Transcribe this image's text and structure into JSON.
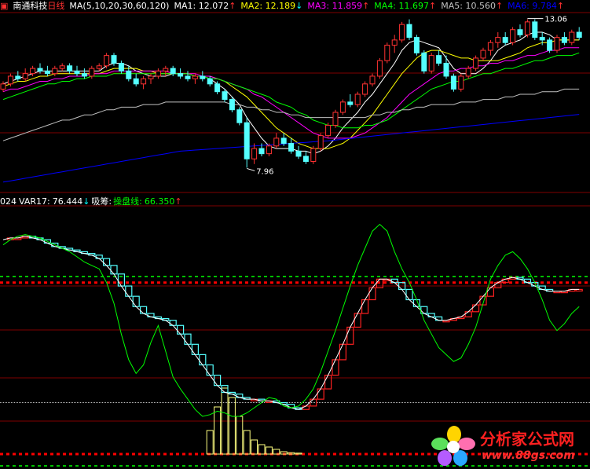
{
  "header1": {
    "stock_name": "南通科技",
    "period": "日线",
    "ma_params": "MA(5,10,20,30,60,120)",
    "ma_items": [
      {
        "label": "MA1:",
        "value": "12.072",
        "arrow": "↑",
        "color": "#ffffff"
      },
      {
        "label": "MA2:",
        "value": "12.189",
        "arrow": "↓",
        "color": "#ffff00"
      },
      {
        "label": "MA3:",
        "value": "11.859",
        "arrow": "↑",
        "color": "#ff00ff"
      },
      {
        "label": "MA4:",
        "value": "11.697",
        "arrow": "↑",
        "color": "#00ff00"
      },
      {
        "label": "MA5:",
        "value": "10.560",
        "arrow": "↑",
        "color": "#c0c0c0"
      },
      {
        "label": "MA6:",
        "value": "9.784",
        "arrow": "↑",
        "color": "#0000ff"
      }
    ]
  },
  "header2": {
    "prefix": "024",
    "var_label": "VAR17:",
    "var_value": "76.444",
    "var_arrow": "↓",
    "label2": "吸筹:",
    "label3": "操盘线:",
    "value3": "66.350",
    "arrow3": "↑"
  },
  "annotations": {
    "low": "7.96",
    "high": "13.06"
  },
  "watermark": {
    "title": "分析家公式网",
    "url": "www.88gs.com"
  },
  "colors": {
    "up": "#ff3232",
    "down": "#54ffff",
    "grid": "#800000",
    "green": "#00ff00",
    "ma_blue": "#0000ff"
  },
  "chart_data": {
    "type": "candlestick",
    "candles": [
      [
        11.0,
        11.3,
        10.9,
        11.2
      ],
      [
        11.2,
        11.6,
        11.1,
        11.5
      ],
      [
        11.5,
        11.7,
        11.3,
        11.4
      ],
      [
        11.4,
        11.8,
        11.3,
        11.6
      ],
      [
        11.6,
        11.9,
        11.5,
        11.8
      ],
      [
        11.8,
        12.0,
        11.6,
        11.7
      ],
      [
        11.7,
        11.9,
        11.5,
        11.6
      ],
      [
        11.6,
        11.9,
        11.5,
        11.8
      ],
      [
        11.8,
        12.0,
        11.7,
        11.9
      ],
      [
        11.9,
        12.0,
        11.6,
        11.7
      ],
      [
        11.7,
        11.9,
        11.5,
        11.6
      ],
      [
        11.6,
        11.8,
        11.4,
        11.5
      ],
      [
        11.5,
        11.9,
        11.4,
        11.8
      ],
      [
        11.8,
        12.0,
        11.7,
        11.9
      ],
      [
        11.9,
        12.4,
        11.8,
        12.3
      ],
      [
        12.3,
        12.4,
        11.9,
        12.0
      ],
      [
        12.0,
        12.1,
        11.6,
        11.7
      ],
      [
        11.7,
        11.9,
        11.3,
        11.4
      ],
      [
        11.4,
        11.6,
        11.1,
        11.2
      ],
      [
        11.2,
        11.5,
        11.0,
        11.4
      ],
      [
        11.4,
        11.6,
        11.2,
        11.5
      ],
      [
        11.5,
        11.8,
        11.4,
        11.7
      ],
      [
        11.7,
        11.9,
        11.5,
        11.8
      ],
      [
        11.8,
        11.9,
        11.5,
        11.6
      ],
      [
        11.6,
        11.8,
        11.4,
        11.5
      ],
      [
        11.5,
        11.7,
        11.3,
        11.4
      ],
      [
        11.4,
        11.6,
        11.2,
        11.5
      ],
      [
        11.5,
        11.7,
        11.3,
        11.4
      ],
      [
        11.4,
        11.5,
        11.1,
        11.2
      ],
      [
        11.2,
        11.3,
        10.8,
        10.9
      ],
      [
        10.9,
        11.0,
        10.5,
        10.6
      ],
      [
        10.6,
        10.7,
        10.1,
        10.2
      ],
      [
        10.2,
        10.3,
        9.6,
        9.7
      ],
      [
        9.7,
        9.9,
        7.96,
        8.3
      ],
      [
        8.3,
        8.9,
        8.1,
        8.7
      ],
      [
        8.7,
        8.9,
        8.4,
        8.5
      ],
      [
        8.5,
        8.9,
        8.4,
        8.8
      ],
      [
        8.8,
        9.3,
        8.7,
        9.1
      ],
      [
        9.1,
        9.3,
        8.8,
        8.9
      ],
      [
        8.9,
        9.1,
        8.5,
        8.6
      ],
      [
        8.6,
        8.8,
        8.3,
        8.4
      ],
      [
        8.4,
        8.6,
        8.1,
        8.2
      ],
      [
        8.2,
        8.8,
        8.1,
        8.7
      ],
      [
        8.7,
        9.3,
        8.6,
        9.2
      ],
      [
        9.2,
        9.7,
        9.1,
        9.6
      ],
      [
        9.6,
        10.2,
        9.5,
        10.1
      ],
      [
        10.1,
        10.6,
        10.0,
        10.5
      ],
      [
        10.5,
        10.8,
        10.3,
        10.4
      ],
      [
        10.4,
        10.9,
        10.3,
        10.8
      ],
      [
        10.8,
        11.3,
        10.7,
        11.2
      ],
      [
        11.2,
        11.6,
        11.1,
        11.5
      ],
      [
        11.5,
        12.2,
        11.4,
        12.1
      ],
      [
        12.1,
        12.8,
        12.0,
        12.7
      ],
      [
        12.7,
        13.1,
        12.4,
        12.9
      ],
      [
        12.9,
        13.6,
        12.8,
        13.5
      ],
      [
        13.5,
        13.7,
        12.9,
        13.0
      ],
      [
        13.0,
        13.1,
        12.3,
        12.4
      ],
      [
        12.4,
        12.5,
        11.6,
        11.7
      ],
      [
        11.7,
        12.4,
        11.6,
        12.3
      ],
      [
        12.3,
        12.5,
        11.9,
        12.0
      ],
      [
        12.0,
        12.3,
        11.4,
        11.5
      ],
      [
        11.5,
        11.6,
        10.9,
        11.0
      ],
      [
        11.0,
        11.6,
        10.9,
        11.5
      ],
      [
        11.5,
        11.9,
        11.4,
        11.8
      ],
      [
        11.8,
        12.3,
        11.7,
        12.2
      ],
      [
        12.2,
        12.6,
        12.1,
        12.5
      ],
      [
        12.5,
        12.9,
        12.3,
        12.8
      ],
      [
        12.8,
        13.2,
        12.6,
        13.0
      ],
      [
        13.0,
        13.2,
        12.7,
        12.8
      ],
      [
        12.8,
        13.4,
        12.7,
        13.3
      ],
      [
        13.3,
        13.5,
        13.0,
        13.1
      ],
      [
        13.1,
        13.7,
        13.0,
        13.6
      ],
      [
        13.6,
        13.7,
        12.9,
        13.0
      ],
      [
        13.0,
        13.2,
        12.7,
        12.9
      ],
      [
        12.9,
        13.0,
        12.4,
        12.5
      ],
      [
        12.5,
        13.1,
        12.4,
        13.0
      ],
      [
        13.0,
        13.2,
        12.7,
        12.8
      ],
      [
        12.8,
        13.3,
        12.7,
        13.2
      ],
      [
        13.2,
        13.4,
        12.9,
        13.0
      ]
    ],
    "ma_series": [
      {
        "name": "MA1",
        "values": [
          11.2,
          11.3,
          11.4,
          11.5,
          11.6,
          11.7,
          11.7,
          11.7,
          11.7,
          11.7,
          11.7,
          11.7,
          11.7,
          11.7,
          11.9,
          12.0,
          12.0,
          11.9,
          11.7,
          11.6,
          11.5,
          11.5,
          11.5,
          11.6,
          11.6,
          11.6,
          11.5,
          11.5,
          11.4,
          11.2,
          11.0,
          10.7,
          10.4,
          9.9,
          9.5,
          9.1,
          8.8,
          8.7,
          8.7,
          8.7,
          8.6,
          8.6,
          8.5,
          8.6,
          8.8,
          9.1,
          9.5,
          9.8,
          10.1,
          10.5,
          10.8,
          11.2,
          11.6,
          12.0,
          12.5,
          12.8,
          12.9,
          12.8,
          12.7,
          12.6,
          12.2,
          11.8,
          11.6,
          11.6,
          11.6,
          11.8,
          12.1,
          12.5,
          12.7,
          12.8,
          12.9,
          13.1,
          13.2,
          13.2,
          13.1,
          12.9,
          12.9,
          12.9,
          12.9
        ]
      },
      {
        "name": "MA2",
        "values": [
          11.1,
          11.2,
          11.3,
          11.3,
          11.4,
          11.5,
          11.5,
          11.6,
          11.6,
          11.6,
          11.6,
          11.6,
          11.6,
          11.6,
          11.7,
          11.8,
          11.8,
          11.8,
          11.8,
          11.7,
          11.7,
          11.6,
          11.6,
          11.6,
          11.6,
          11.6,
          11.5,
          11.5,
          11.5,
          11.4,
          11.3,
          11.1,
          10.9,
          10.7,
          10.4,
          10.1,
          9.8,
          9.5,
          9.3,
          9.1,
          8.9,
          8.8,
          8.7,
          8.7,
          8.7,
          8.8,
          8.9,
          9.1,
          9.4,
          9.7,
          10.0,
          10.4,
          10.8,
          11.2,
          11.6,
          11.9,
          12.2,
          12.4,
          12.5,
          12.5,
          12.4,
          12.3,
          12.2,
          12.2,
          12.1,
          12.1,
          12.1,
          12.1,
          12.2,
          12.3,
          12.4,
          12.6,
          12.7,
          12.8,
          12.8,
          12.9,
          12.9,
          12.9,
          12.9
        ]
      },
      {
        "name": "MA3",
        "values": [
          10.9,
          11.0,
          11.0,
          11.1,
          11.2,
          11.3,
          11.3,
          11.4,
          11.4,
          11.5,
          11.5,
          11.5,
          11.6,
          11.6,
          11.6,
          11.7,
          11.7,
          11.7,
          11.7,
          11.7,
          11.7,
          11.7,
          11.7,
          11.6,
          11.6,
          11.6,
          11.6,
          11.5,
          11.5,
          11.4,
          11.3,
          11.2,
          11.1,
          11.0,
          10.8,
          10.7,
          10.5,
          10.3,
          10.1,
          9.9,
          9.7,
          9.5,
          9.3,
          9.2,
          9.1,
          9.1,
          9.1,
          9.1,
          9.2,
          9.3,
          9.5,
          9.7,
          9.9,
          10.2,
          10.5,
          10.8,
          11.0,
          11.2,
          11.4,
          11.6,
          11.7,
          11.7,
          11.8,
          11.8,
          11.9,
          11.9,
          12.0,
          12.0,
          12.1,
          12.1,
          12.2,
          12.3,
          12.3,
          12.4,
          12.5,
          12.5,
          12.6,
          12.6,
          12.6
        ]
      },
      {
        "name": "MA4",
        "values": [
          10.6,
          10.7,
          10.8,
          10.9,
          11.0,
          11.1,
          11.2,
          11.2,
          11.3,
          11.3,
          11.4,
          11.4,
          11.5,
          11.5,
          11.5,
          11.6,
          11.6,
          11.6,
          11.6,
          11.6,
          11.6,
          11.6,
          11.6,
          11.6,
          11.6,
          11.6,
          11.5,
          11.5,
          11.4,
          11.4,
          11.3,
          11.2,
          11.1,
          11.0,
          10.9,
          10.8,
          10.7,
          10.5,
          10.4,
          10.3,
          10.1,
          10.0,
          9.8,
          9.7,
          9.6,
          9.6,
          9.5,
          9.5,
          9.5,
          9.6,
          9.6,
          9.7,
          9.8,
          10.0,
          10.2,
          10.4,
          10.6,
          10.8,
          11.0,
          11.1,
          11.2,
          11.3,
          11.3,
          11.4,
          11.5,
          11.6,
          11.6,
          11.7,
          11.8,
          11.8,
          11.9,
          12.0,
          12.1,
          12.1,
          12.2,
          12.3,
          12.3,
          12.3,
          12.4
        ]
      },
      {
        "name": "MA5",
        "values": [
          9.0,
          9.1,
          9.2,
          9.3,
          9.4,
          9.5,
          9.6,
          9.7,
          9.8,
          9.8,
          9.9,
          10.0,
          10.0,
          10.1,
          10.2,
          10.2,
          10.3,
          10.3,
          10.3,
          10.4,
          10.4,
          10.4,
          10.5,
          10.5,
          10.5,
          10.5,
          10.5,
          10.5,
          10.5,
          10.5,
          10.5,
          10.4,
          10.4,
          10.3,
          10.3,
          10.2,
          10.2,
          10.1,
          10.1,
          10.0,
          10.0,
          9.9,
          9.9,
          9.9,
          9.9,
          9.9,
          9.9,
          9.9,
          9.9,
          9.9,
          10.0,
          10.0,
          10.1,
          10.1,
          10.2,
          10.2,
          10.3,
          10.3,
          10.4,
          10.4,
          10.4,
          10.4,
          10.5,
          10.5,
          10.5,
          10.6,
          10.6,
          10.6,
          10.7,
          10.7,
          10.8,
          10.8,
          10.8,
          10.9,
          10.9,
          10.9,
          11.0,
          11.0,
          11.0
        ]
      },
      {
        "name": "MA6",
        "values": [
          7.4,
          7.45,
          7.5,
          7.55,
          7.6,
          7.65,
          7.7,
          7.75,
          7.8,
          7.85,
          7.9,
          7.95,
          8.0,
          8.05,
          8.1,
          8.15,
          8.2,
          8.25,
          8.3,
          8.35,
          8.4,
          8.45,
          8.5,
          8.55,
          8.6,
          8.62,
          8.64,
          8.66,
          8.68,
          8.7,
          8.72,
          8.74,
          8.76,
          8.78,
          8.8,
          8.82,
          8.84,
          8.86,
          8.88,
          8.9,
          8.92,
          8.94,
          8.96,
          8.98,
          9.0,
          9.03,
          9.06,
          9.09,
          9.12,
          9.15,
          9.18,
          9.21,
          9.24,
          9.27,
          9.3,
          9.33,
          9.36,
          9.39,
          9.42,
          9.45,
          9.48,
          9.51,
          9.54,
          9.57,
          9.6,
          9.63,
          9.66,
          9.69,
          9.72,
          9.75,
          9.78,
          9.81,
          9.84,
          9.87,
          9.9,
          9.93,
          9.96,
          9.99,
          10.02
        ]
      }
    ],
    "ind_green": [
      92,
      95,
      97,
      98,
      97,
      96,
      94,
      92,
      90,
      88,
      85,
      82,
      80,
      78,
      70,
      58,
      40,
      25,
      17,
      22,
      35,
      45,
      30,
      15,
      8,
      2,
      -4,
      -8,
      -7,
      -5,
      -6,
      -8,
      -8,
      -6,
      -3,
      0,
      3,
      2,
      -2,
      -3,
      -2,
      2,
      8,
      18,
      30,
      42,
      55,
      68,
      80,
      90,
      100,
      104,
      100,
      88,
      78,
      70,
      60,
      48,
      40,
      32,
      28,
      24,
      26,
      34,
      44,
      58,
      72,
      80,
      86,
      88,
      84,
      78,
      70,
      60,
      48,
      42,
      46,
      52,
      56
    ],
    "ind_white": [
      95,
      96,
      96,
      97,
      96,
      95,
      93,
      91,
      90,
      89,
      88,
      87,
      86,
      84,
      80,
      75,
      68,
      62,
      56,
      52,
      50,
      49,
      48,
      45,
      40,
      34,
      28,
      22,
      16,
      10,
      6,
      5,
      3,
      2,
      2,
      1,
      1,
      0,
      -1,
      -3,
      -4,
      -2,
      2,
      8,
      16,
      25,
      34,
      44,
      52,
      60,
      67,
      72,
      72,
      70,
      66,
      60,
      56,
      52,
      50,
      48,
      48,
      49,
      50,
      53,
      57,
      62,
      67,
      70,
      72,
      73,
      72,
      70,
      68,
      66,
      65,
      65,
      65,
      66,
      66
    ],
    "ind_bars": [
      0,
      0,
      0,
      0,
      0,
      0,
      0,
      0,
      0,
      0,
      0,
      0,
      0,
      0,
      0,
      0,
      0,
      0,
      0,
      0,
      0,
      0,
      0,
      0,
      0,
      0,
      0,
      0,
      5,
      10,
      14,
      12,
      8,
      5,
      3,
      2,
      1.5,
      1,
      0.5,
      0.3,
      0.2,
      0,
      0,
      0,
      0,
      0,
      0,
      0,
      0,
      0,
      0,
      0,
      0,
      0,
      0,
      0,
      0,
      0,
      0,
      0,
      0,
      0,
      0,
      0,
      0,
      0,
      0,
      0,
      0,
      0,
      0,
      0,
      0,
      0,
      0,
      0,
      0,
      0,
      0
    ]
  }
}
